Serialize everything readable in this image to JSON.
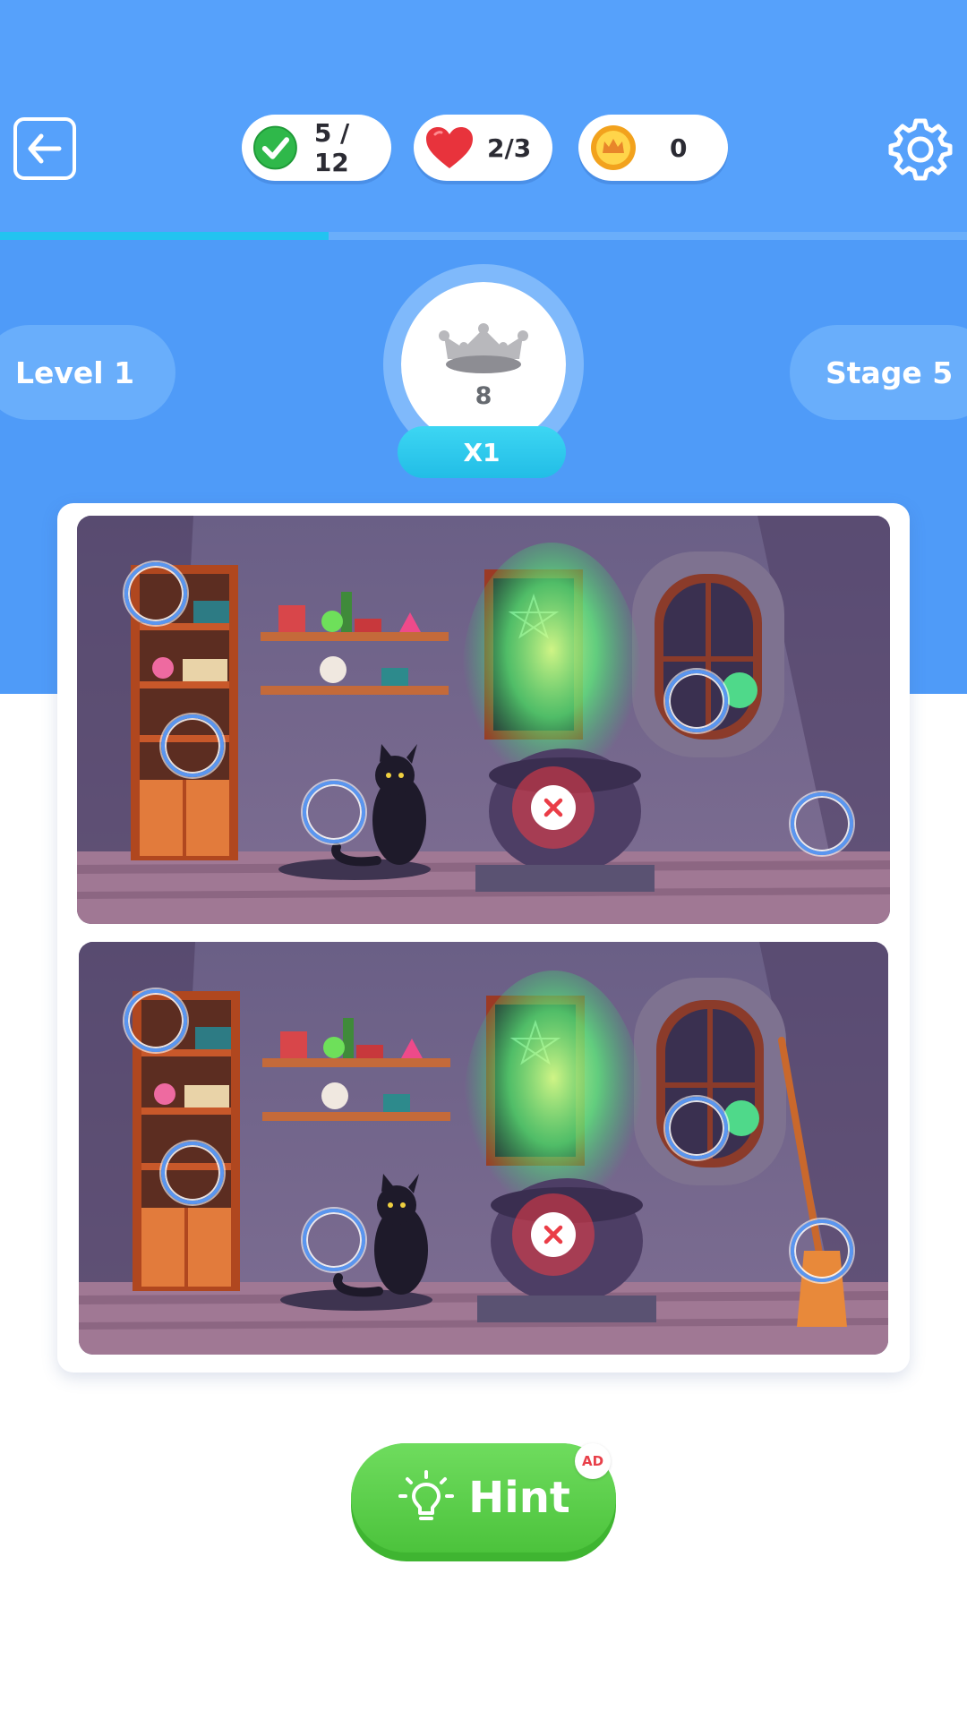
{
  "header": {
    "found_count": "5 / 12",
    "lives": "2/3",
    "coins": "0",
    "progress_fraction": 0.34
  },
  "level": {
    "level_label": "Level 1",
    "stage_label": "Stage 5",
    "crown_count": "8",
    "multiplier": "X1"
  },
  "hint": {
    "label": "Hint",
    "ad_badge": "AD"
  },
  "colors": {
    "header_blue": "#56a1fb",
    "accent_cyan": "#22c3f0",
    "hint_green": "#4cc33c",
    "found_marker": "#5a96f0",
    "wrong_marker": "#f03c46"
  },
  "icons": {
    "back": "back-arrow-icon",
    "found": "check-icon",
    "lives": "heart-icon",
    "coins": "crown-coin-icon",
    "settings": "gear-icon",
    "crown": "crown-icon",
    "hint": "lightbulb-icon"
  }
}
